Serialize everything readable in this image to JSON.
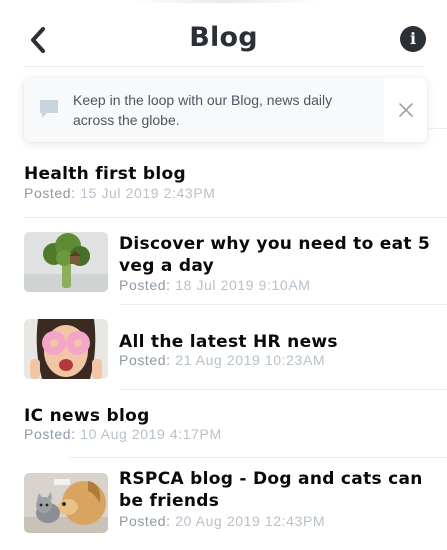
{
  "header": {
    "title": "Blog",
    "back_icon": "chevron-left-icon",
    "info_icon": "info-icon"
  },
  "banner": {
    "text": "Keep in the loop with our Blog, news daily across the globe.",
    "icon": "chat-bubble-icon",
    "close_icon": "close-icon"
  },
  "posted_label": "Posted:",
  "posts": [
    {
      "title": "Health first blog",
      "date": "15 Jul 2019 2:43PM",
      "thumbnail": null
    },
    {
      "title": "Discover why you need to eat 5 veg a day",
      "date": "18 Jul 2019 9:10AM",
      "thumbnail": "broccoli-treehouse-image"
    },
    {
      "title": "All the latest HR news",
      "date": "21 Aug 2019 10:23AM",
      "thumbnail": "woman-donut-eyes-image"
    },
    {
      "title": "IC news blog",
      "date": "10 Aug 2019 4:17PM",
      "thumbnail": null
    },
    {
      "title": "RSPCA blog - Dog and cats can be friends",
      "date": "20 Aug 2019 12:43PM",
      "thumbnail": "dog-and-kitten-image"
    }
  ],
  "colors": {
    "title": "#2b2f36",
    "label": "#8e9aa6",
    "date": "#b7c1cb",
    "banner_text": "#4b5563"
  }
}
